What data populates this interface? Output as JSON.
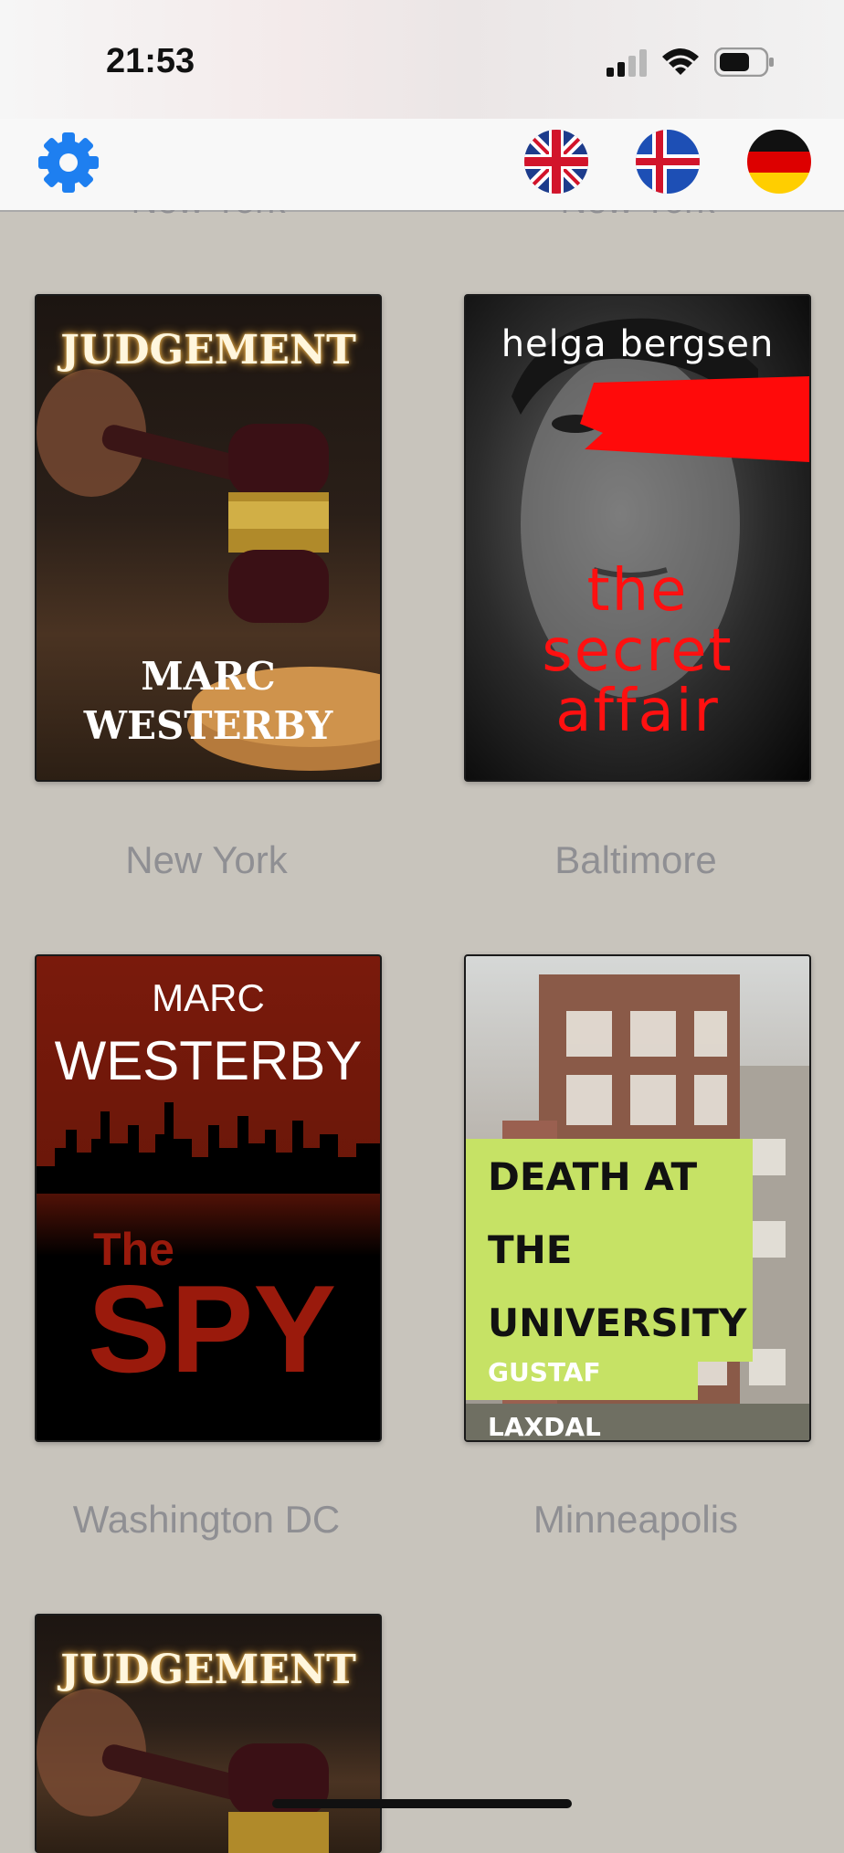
{
  "status_bar": {
    "time": "21:53"
  },
  "nav": {
    "settings_icon": "gear-icon",
    "languages": [
      {
        "code": "en",
        "icon": "uk-flag-icon"
      },
      {
        "code": "is",
        "icon": "iceland-flag-icon"
      },
      {
        "code": "de",
        "icon": "germany-flag-icon"
      }
    ],
    "accent_color": "#1e7ff0"
  },
  "partial_row": {
    "left_city": "New York",
    "right_city": "New York"
  },
  "books": [
    {
      "title": "JUDGEMENT",
      "author_line1": "MARC",
      "author_line2": "WESTERBY",
      "city": "New York"
    },
    {
      "title_line1": "the",
      "title_line2": "secret",
      "title_line3": "affair",
      "author": "helga bergsen",
      "city": "Baltimore"
    },
    {
      "author_line1": "MARC",
      "author_line2": "WESTERBY",
      "title_small": "The",
      "title_large": "SPY",
      "city": "Washington DC"
    },
    {
      "title_line1": "DEATH AT THE",
      "title_line2": "UNIVERSITY",
      "author": "GUSTAF LAXDAL",
      "city": "Minneapolis"
    },
    {
      "title": "JUDGEMENT"
    }
  ]
}
